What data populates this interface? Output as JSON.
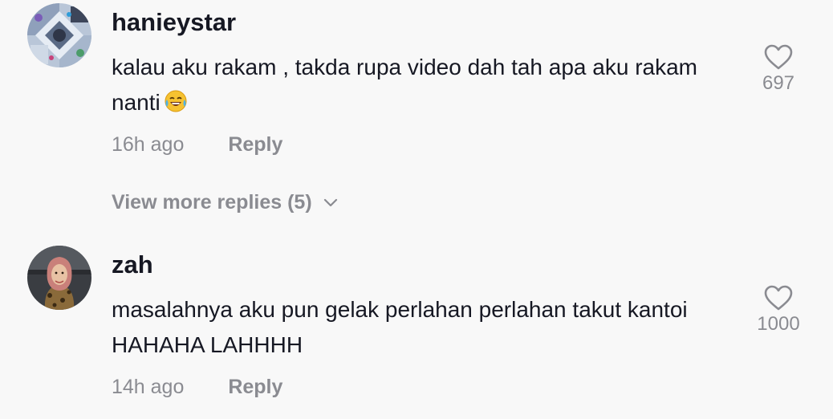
{
  "comments": [
    {
      "username": "hanieystar",
      "text": "kalau aku rakam , takda rupa video dah tah apa aku rakam nanti",
      "emoji": "face-with-tears-of-joy-icon",
      "time": "16h ago",
      "reply_label": "Reply",
      "likes": "697",
      "view_more_label": "View more replies (5)"
    },
    {
      "username": "zah",
      "text": "masalahnya aku pun gelak perlahan perlahan takut kantoi HAHAHA LAHHHH",
      "time": "14h ago",
      "reply_label": "Reply",
      "likes": "1000"
    }
  ],
  "colors": {
    "background": "#f8f8f8",
    "primary_text": "#161823",
    "secondary_text": "#8a8b91",
    "emoji_yellow": "#f6c231"
  },
  "icons": [
    "heart-outline-icon",
    "chevron-down-icon",
    "face-with-tears-of-joy-icon"
  ]
}
